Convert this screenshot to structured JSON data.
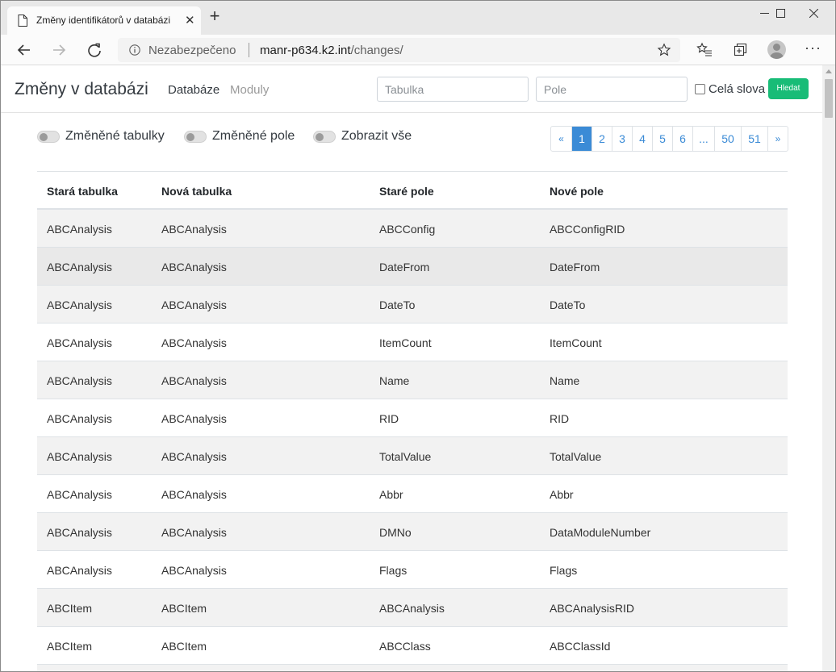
{
  "browser": {
    "tab_title": "Změny identifikátorů v databázi",
    "address_security": "Nezabezpečeno",
    "address_host": "manr-p634.k2.int",
    "address_path": "/changes/"
  },
  "header": {
    "brand": "Změny v databázi",
    "nav": {
      "databases": "Databáze",
      "modules": "Moduly"
    },
    "table_placeholder": "Tabulka",
    "field_placeholder": "Pole",
    "whole_words_label": "Celá slova",
    "search_button": "Hledat"
  },
  "filters": {
    "changed_tables": "Změněné tabulky",
    "changed_fields": "Změněné pole",
    "show_all": "Zobrazit vše"
  },
  "pagination": {
    "prev": "«",
    "pages": [
      "1",
      "2",
      "3",
      "4",
      "5",
      "6",
      "...",
      "50",
      "51"
    ],
    "next": "»",
    "current": "1"
  },
  "table": {
    "headers": [
      "Stará tabulka",
      "Nová tabulka",
      "Staré pole",
      "Nové pole"
    ],
    "rows": [
      [
        "ABCAnalysis",
        "ABCAnalysis",
        "ABCConfig",
        "ABCConfigRID"
      ],
      [
        "ABCAnalysis",
        "ABCAnalysis",
        "DateFrom",
        "DateFrom"
      ],
      [
        "ABCAnalysis",
        "ABCAnalysis",
        "DateTo",
        "DateTo"
      ],
      [
        "ABCAnalysis",
        "ABCAnalysis",
        "ItemCount",
        "ItemCount"
      ],
      [
        "ABCAnalysis",
        "ABCAnalysis",
        "Name",
        "Name"
      ],
      [
        "ABCAnalysis",
        "ABCAnalysis",
        "RID",
        "RID"
      ],
      [
        "ABCAnalysis",
        "ABCAnalysis",
        "TotalValue",
        "TotalValue"
      ],
      [
        "ABCAnalysis",
        "ABCAnalysis",
        "Abbr",
        "Abbr"
      ],
      [
        "ABCAnalysis",
        "ABCAnalysis",
        "DMNo",
        "DataModuleNumber"
      ],
      [
        "ABCAnalysis",
        "ABCAnalysis",
        "Flags",
        "Flags"
      ],
      [
        "ABCItem",
        "ABCItem",
        "ABCAnalysis",
        "ABCAnalysisRID"
      ],
      [
        "ABCItem",
        "ABCItem",
        "ABCClass",
        "ABCClassId"
      ]
    ]
  },
  "colors": {
    "accent": "#3b8bd6",
    "search_button": "#18bc77"
  }
}
